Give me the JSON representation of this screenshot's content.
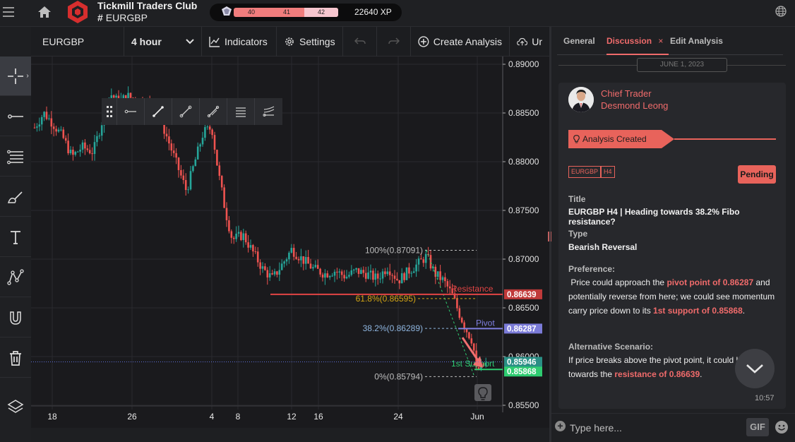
{
  "header": {
    "brand": "Tickmill Traders Club",
    "room_hash": "#",
    "room": "EURGBP",
    "levels": [
      "40",
      "41",
      "42"
    ],
    "xp": "22640 XP"
  },
  "chart_toolbar": {
    "symbol": "EURGBP",
    "interval": "4 hour",
    "indicators": "Indicators",
    "settings": "Settings",
    "create_analysis": "Create Analysis",
    "upload_partial": "Ur"
  },
  "chart_data": {
    "type": "candlestick",
    "symbol": "EURGBP",
    "y_ticks": [
      "0.89000",
      "0.88500",
      "0.88000",
      "0.87500",
      "0.87000",
      "0.86500",
      "0.86000",
      "0.85500"
    ],
    "x_ticks": [
      "18",
      "26",
      "4",
      "8",
      "12",
      "16",
      "24",
      "Jun"
    ],
    "ylim": [
      0.855,
      0.89
    ],
    "fib_levels": [
      {
        "label": "100%(0.87091)",
        "value": 0.87091,
        "color": "#bdbdbd"
      },
      {
        "label": "61.8%(0.86595)",
        "value": 0.86595,
        "color": "#d4a514"
      },
      {
        "label": "38.2%(0.86289)",
        "value": 0.86289,
        "color": "#8fb6e0"
      },
      {
        "label": "0%(0.85794)",
        "value": 0.85794,
        "color": "#bdbdbd"
      }
    ],
    "annotations": [
      {
        "label": "Resistance",
        "value": 0.86639,
        "color": "#e24444",
        "tag": "0.86639"
      },
      {
        "label": "Pivot",
        "value": 0.86287,
        "color": "#7f7fe0",
        "tag": "0.86287"
      },
      {
        "label": "1st Support",
        "value": 0.85868,
        "color": "#2ecc71",
        "tag": "0.85868"
      }
    ],
    "current_price": {
      "value": 0.85946,
      "tag": "0.85946",
      "color": "#26a69a"
    }
  },
  "panel": {
    "tabs": [
      "General",
      "Discussion",
      "Edit Analysis"
    ],
    "tab_close": "×",
    "date": "JUNE 1, 2023",
    "author_role": "Chief Trader",
    "author_name": "Desmond Leong",
    "status_banner": "Analysis Created",
    "tags": [
      "EURGBP",
      "H4"
    ],
    "status": "Pending",
    "title_label": "Title",
    "title": "EURGBP H4 | Heading towards 38.2% Fibo resistance?",
    "type_label": "Type",
    "type": "Bearish Reversal",
    "preference_label": "Preference:",
    "pref_1": " Price could approach the ",
    "pref_2": "pivot point of 0.86287",
    "pref_3": " and potentially reverse from here; we could see momentum carry price down to its ",
    "pref_4": "1st support of 0.85868",
    "pref_5": ".",
    "alt_label": "Alternative Scenario:",
    "alt_1": "If price breaks above the pivot point, it could head towards the ",
    "alt_2": "resistance of 0.86639",
    "alt_3": ".",
    "time": "10:57",
    "placeholder": "Type here...",
    "gif": "GIF"
  },
  "colors": {
    "accent": "#f06b6b",
    "up": "#26a69a",
    "down": "#ef5350"
  }
}
